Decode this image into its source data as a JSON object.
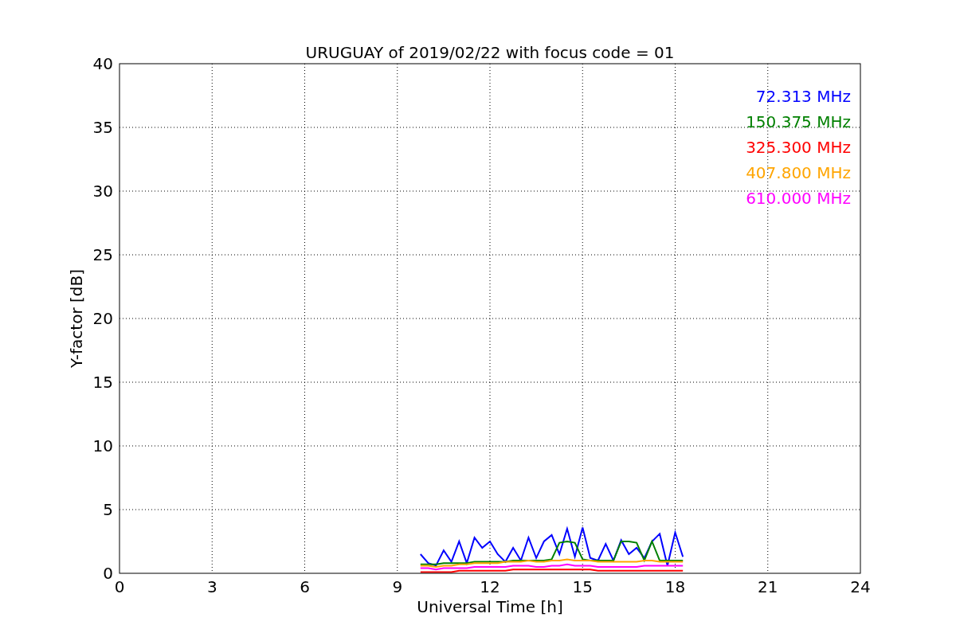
{
  "chart_data": {
    "type": "line",
    "grid": true,
    "title": "URUGUAY of 2019/02/22 with focus code = 01",
    "xlabel": "Universal Time [h]",
    "ylabel": "Y-factor [dB]",
    "xlim": [
      0,
      24
    ],
    "ylim": [
      0,
      40
    ],
    "xticks": [
      0,
      3,
      6,
      9,
      12,
      15,
      18,
      21,
      24
    ],
    "yticks": [
      0,
      5,
      10,
      15,
      20,
      25,
      30,
      35,
      40
    ],
    "x": [
      9.75,
      10,
      10.25,
      10.5,
      10.75,
      11,
      11.25,
      11.5,
      11.75,
      12,
      12.25,
      12.5,
      12.75,
      13,
      13.25,
      13.5,
      13.75,
      14,
      14.25,
      14.5,
      14.75,
      15,
      15.25,
      15.5,
      15.75,
      16,
      16.25,
      16.5,
      16.75,
      17,
      17.25,
      17.5,
      17.75,
      18,
      18.25
    ],
    "series": [
      {
        "name": "72.313 MHz",
        "color": "#0000ff",
        "values": [
          1.5,
          0.8,
          0.6,
          1.8,
          0.9,
          2.5,
          0.8,
          2.8,
          2.0,
          2.5,
          1.5,
          0.9,
          2.0,
          1.0,
          2.8,
          1.2,
          2.5,
          3.0,
          1.5,
          3.5,
          1.3,
          3.6,
          1.2,
          1.0,
          2.3,
          1.0,
          2.6,
          1.5,
          2.0,
          1.2,
          2.5,
          3.1,
          0.6,
          3.2,
          1.3
        ]
      },
      {
        "name": "150.375 MHz",
        "color": "#008000",
        "values": [
          0.7,
          0.7,
          0.7,
          0.8,
          0.8,
          0.8,
          0.8,
          0.9,
          0.9,
          0.9,
          0.9,
          0.9,
          1.0,
          1.0,
          1.0,
          1.0,
          1.0,
          1.1,
          2.4,
          2.5,
          2.4,
          1.1,
          1.0,
          1.0,
          1.0,
          1.0,
          2.5,
          2.5,
          2.4,
          1.0,
          2.5,
          1.0,
          1.0,
          1.0,
          1.0
        ]
      },
      {
        "name": "325.300 MHz",
        "color": "#ff0000",
        "values": [
          0.1,
          0.1,
          0.1,
          0.1,
          0.1,
          0.2,
          0.2,
          0.2,
          0.2,
          0.2,
          0.2,
          0.2,
          0.3,
          0.3,
          0.3,
          0.3,
          0.3,
          0.3,
          0.3,
          0.3,
          0.3,
          0.3,
          0.3,
          0.2,
          0.2,
          0.2,
          0.2,
          0.2,
          0.2,
          0.2,
          0.2,
          0.2,
          0.2,
          0.2,
          0.2
        ]
      },
      {
        "name": "407.800 MHz",
        "color": "#ffa500",
        "values": [
          0.6,
          0.6,
          0.5,
          0.6,
          0.6,
          0.7,
          0.7,
          0.8,
          0.8,
          0.8,
          0.8,
          0.9,
          0.9,
          0.9,
          1.0,
          0.9,
          0.9,
          1.0,
          1.0,
          1.1,
          1.0,
          1.0,
          1.0,
          0.9,
          0.9,
          0.9,
          0.9,
          0.9,
          0.9,
          1.0,
          1.0,
          0.9,
          0.9,
          0.9,
          0.9
        ]
      },
      {
        "name": "610.000 MHz",
        "color": "#ff00ff",
        "values": [
          0.4,
          0.4,
          0.3,
          0.4,
          0.4,
          0.4,
          0.4,
          0.5,
          0.5,
          0.5,
          0.5,
          0.5,
          0.6,
          0.6,
          0.6,
          0.5,
          0.5,
          0.6,
          0.6,
          0.7,
          0.6,
          0.6,
          0.6,
          0.5,
          0.5,
          0.5,
          0.5,
          0.5,
          0.5,
          0.6,
          0.6,
          0.6,
          0.6,
          0.6,
          0.6
        ]
      }
    ]
  }
}
